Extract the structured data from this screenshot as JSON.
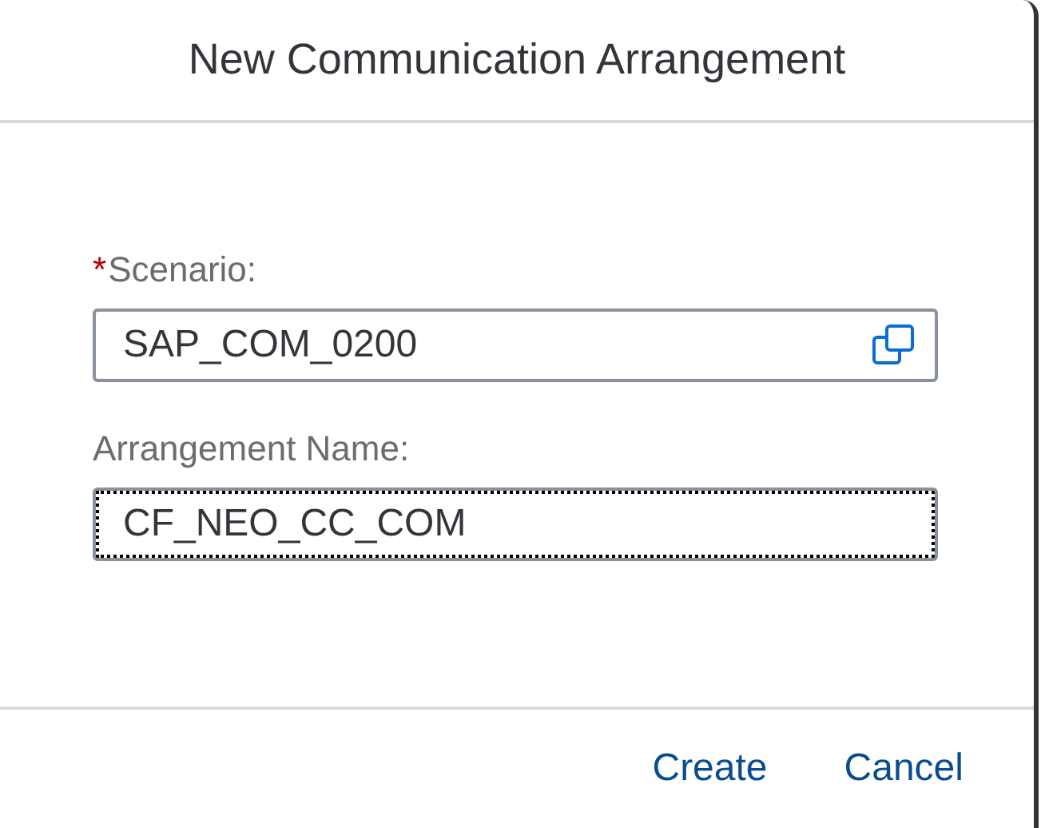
{
  "dialog": {
    "title": "New Communication Arrangement",
    "fields": [
      {
        "required_mark": "*",
        "label": "Scenario:",
        "value": "SAP_COM_0200",
        "kind": "value-help",
        "focused": false
      },
      {
        "label": "Arrangement Name:",
        "value": "CF_NEO_CC_COM",
        "kind": "text",
        "focused": true
      }
    ],
    "buttons": [
      "Create",
      "Cancel"
    ]
  }
}
